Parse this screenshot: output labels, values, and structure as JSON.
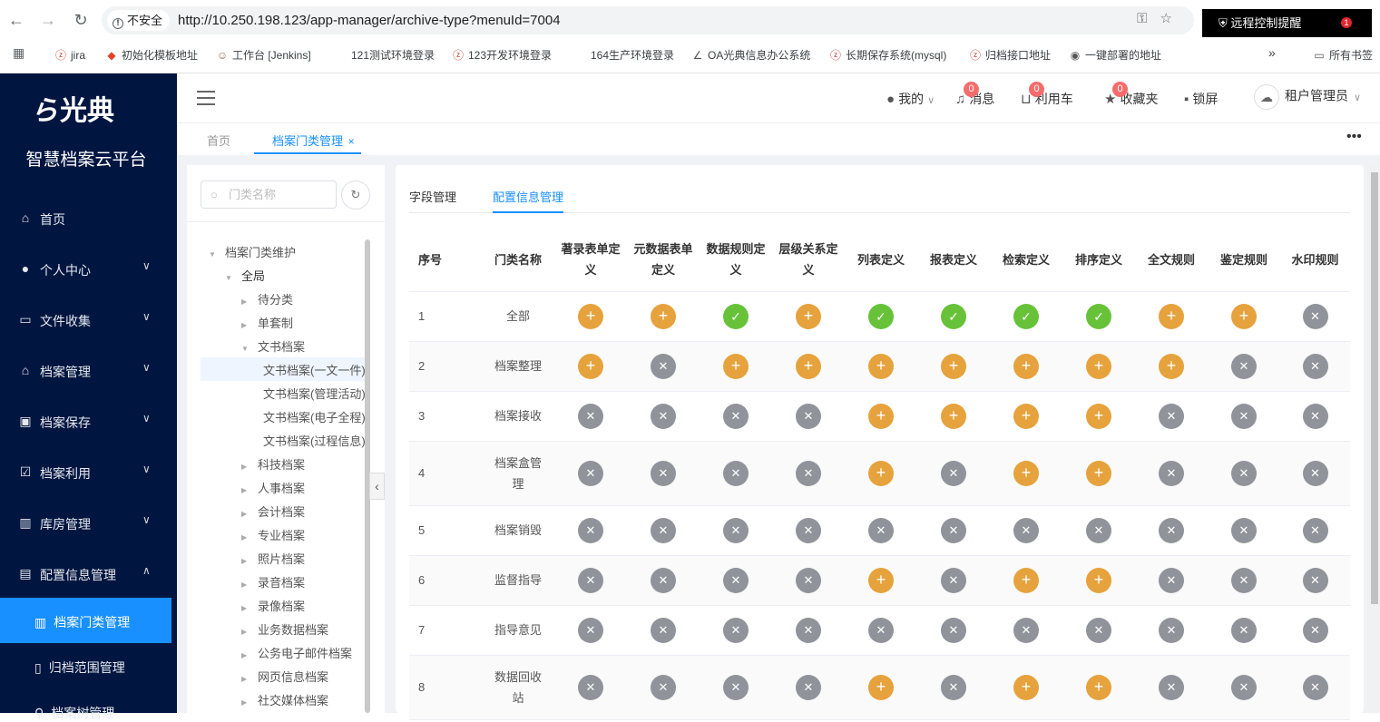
{
  "browser": {
    "insecure_label": "不安全",
    "url": "http://10.250.198.123/app-manager/archive-type?menuId=7004",
    "remote_label": "远程控制提醒",
    "remote_badge": "1",
    "bookmarks": [
      {
        "label": "jira",
        "icon": "jira-icon"
      },
      {
        "label": "初始化模板地址",
        "icon": "gitlab-icon"
      },
      {
        "label": "工作台 [Jenkins]",
        "icon": "jenkins-icon"
      },
      {
        "label": "121测试环境登录",
        "icon": ""
      },
      {
        "label": "123开发环境登录",
        "icon": "zentao-icon"
      },
      {
        "label": "164生产环境登录",
        "icon": ""
      },
      {
        "label": "OA光典信息办公系统",
        "icon": "oa-icon"
      },
      {
        "label": "长期保存系统(mysql)",
        "icon": "zentao-icon"
      },
      {
        "label": "归档接口地址",
        "icon": "zentao-icon"
      },
      {
        "label": "一键部署的地址",
        "icon": "globe-icon"
      }
    ],
    "all_bookmarks": "所有书签"
  },
  "sidebar": {
    "logo_text": "光典",
    "platform": "智慧档案云平台",
    "menu": [
      {
        "label": "首页",
        "icon": "home-icon",
        "expand": ""
      },
      {
        "label": "个人中心",
        "icon": "user-icon",
        "expand": "v"
      },
      {
        "label": "文件收集",
        "icon": "briefcase-icon",
        "expand": "v"
      },
      {
        "label": "档案管理",
        "icon": "bank-icon",
        "expand": "v"
      },
      {
        "label": "档案保存",
        "icon": "save-icon",
        "expand": "v"
      },
      {
        "label": "档案利用",
        "icon": "task-icon",
        "expand": "v"
      },
      {
        "label": "库房管理",
        "icon": "building-icon",
        "expand": "v"
      },
      {
        "label": "配置信息管理",
        "icon": "config-icon",
        "expand": "^"
      }
    ],
    "submenu": [
      {
        "label": "档案门类管理",
        "icon": "books-icon"
      },
      {
        "label": "归档范围管理",
        "icon": "doc-icon"
      },
      {
        "label": "档案树管理",
        "icon": "tree-icon"
      }
    ]
  },
  "header": {
    "mine": "我的",
    "message": "消息",
    "message_count": "0",
    "cart": "利用车",
    "cart_count": "0",
    "favorites": "收藏夹",
    "favorites_count": "0",
    "lock": "锁屏",
    "tenant": "租户管理员"
  },
  "tabs": {
    "home": "首页",
    "active": "档案门类管理",
    "close": "×"
  },
  "tree": {
    "search_placeholder": "门类名称",
    "nodes": [
      {
        "label": "档案门类维护",
        "arrow": "▼"
      },
      {
        "label": "全局",
        "arrow": "▼"
      },
      {
        "label": "待分类",
        "arrow": "▶"
      },
      {
        "label": "单套制",
        "arrow": "▶"
      },
      {
        "label": "文书档案",
        "arrow": "▼"
      },
      {
        "label": "文书档案(一文一件)",
        "arrow": ""
      },
      {
        "label": "文书档案(管理活动)",
        "arrow": ""
      },
      {
        "label": "文书档案(电子全程)",
        "arrow": ""
      },
      {
        "label": "文书档案(过程信息)",
        "arrow": ""
      },
      {
        "label": "科技档案",
        "arrow": "▶"
      },
      {
        "label": "人事档案",
        "arrow": "▶"
      },
      {
        "label": "会计档案",
        "arrow": "▶"
      },
      {
        "label": "专业档案",
        "arrow": "▶"
      },
      {
        "label": "照片档案",
        "arrow": "▶"
      },
      {
        "label": "录音档案",
        "arrow": "▶"
      },
      {
        "label": "录像档案",
        "arrow": "▶"
      },
      {
        "label": "业务数据档案",
        "arrow": "▶"
      },
      {
        "label": "公务电子邮件档案",
        "arrow": "▶"
      },
      {
        "label": "网页信息档案",
        "arrow": "▶"
      },
      {
        "label": "社交媒体档案",
        "arrow": "▶"
      }
    ]
  },
  "main": {
    "tabs": [
      "字段管理",
      "配置信息管理"
    ],
    "columns": [
      "序号",
      "门类名称",
      "著录表单定义",
      "元数据表单定义",
      "数据规则定义",
      "层级关系定义",
      "列表定义",
      "报表定义",
      "检索定义",
      "排序定义",
      "全文规则",
      "鉴定规则",
      "水印规则"
    ],
    "rows": [
      {
        "no": "1",
        "name": "全部",
        "status": [
          "plus",
          "plus",
          "check",
          "plus",
          "check",
          "check",
          "check",
          "check",
          "plus",
          "plus",
          "cross"
        ]
      },
      {
        "no": "2",
        "name": "档案整理",
        "status": [
          "plus",
          "cross",
          "plus",
          "plus",
          "plus",
          "plus",
          "plus",
          "plus",
          "plus",
          "cross",
          "cross"
        ]
      },
      {
        "no": "3",
        "name": "档案接收",
        "status": [
          "cross",
          "cross",
          "cross",
          "cross",
          "plus",
          "plus",
          "plus",
          "plus",
          "cross",
          "cross",
          "cross"
        ]
      },
      {
        "no": "4",
        "name": "档案盒管理",
        "status": [
          "cross",
          "cross",
          "cross",
          "cross",
          "plus",
          "cross",
          "plus",
          "plus",
          "cross",
          "cross",
          "cross"
        ]
      },
      {
        "no": "5",
        "name": "档案销毁",
        "status": [
          "cross",
          "cross",
          "cross",
          "cross",
          "cross",
          "cross",
          "cross",
          "cross",
          "cross",
          "cross",
          "cross"
        ]
      },
      {
        "no": "6",
        "name": "监督指导",
        "status": [
          "cross",
          "cross",
          "cross",
          "cross",
          "plus",
          "cross",
          "plus",
          "plus",
          "cross",
          "cross",
          "cross"
        ]
      },
      {
        "no": "7",
        "name": "指导意见",
        "status": [
          "cross",
          "cross",
          "cross",
          "cross",
          "cross",
          "cross",
          "cross",
          "cross",
          "cross",
          "cross",
          "cross"
        ]
      },
      {
        "no": "8",
        "name": "数据回收站",
        "status": [
          "cross",
          "cross",
          "cross",
          "cross",
          "plus",
          "cross",
          "plus",
          "plus",
          "cross",
          "cross",
          "cross"
        ]
      }
    ],
    "status_glyphs": {
      "plus": "+",
      "check": "✓",
      "cross": "✕"
    },
    "colors": {
      "plus": "#e6a23c",
      "check": "#67c23a",
      "cross": "#909399",
      "accent": "#1890ff",
      "sidebar": "#001640"
    }
  }
}
